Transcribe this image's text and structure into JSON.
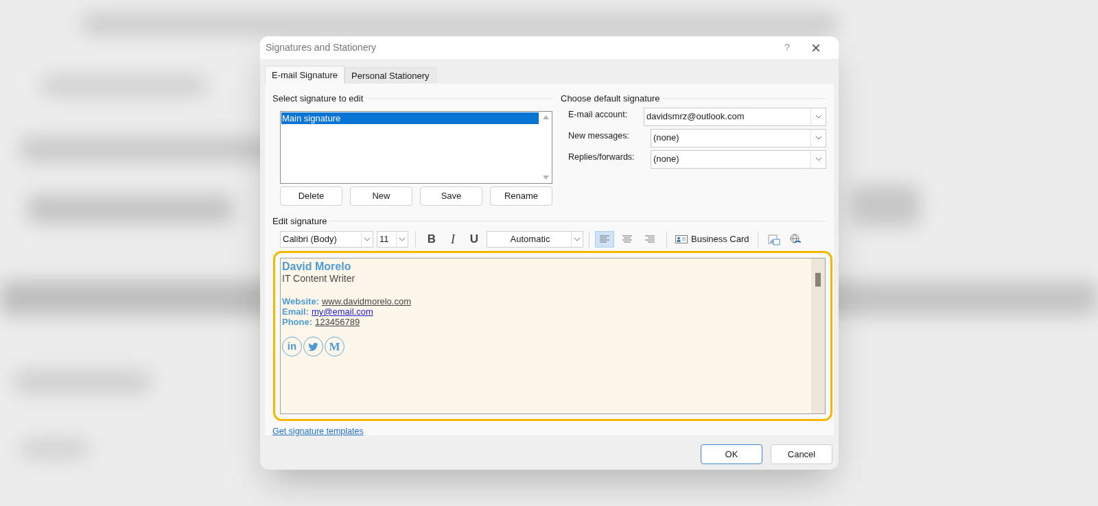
{
  "window": {
    "title": "Signatures and Stationery",
    "help": "?",
    "close": "×"
  },
  "tabs": [
    {
      "label": "E-mail Signature",
      "selected": true
    },
    {
      "label": "Personal Stationery",
      "selected": false
    }
  ],
  "select_signature": {
    "heading": "Select signature to edit",
    "items": [
      {
        "label": "Main signature",
        "selected": true
      }
    ],
    "buttons": [
      "Delete",
      "New",
      "Save",
      "Rename"
    ]
  },
  "default_signature": {
    "heading": "Choose default signature",
    "fields": [
      {
        "label": "E-mail account:",
        "value": "davidsmrz@outlook.com"
      },
      {
        "label": "New messages:",
        "value": "(none)"
      },
      {
        "label": "Replies/forwards:",
        "value": "(none)"
      }
    ]
  },
  "edit_signature": {
    "heading": "Edit signature",
    "toolbar": {
      "font": "Calibri (Body)",
      "size": "11",
      "bold": "B",
      "italic": "I",
      "underline": "U",
      "font_color": "Automatic",
      "align": [
        {
          "kind": "left",
          "selected": true
        },
        {
          "kind": "center",
          "selected": false
        },
        {
          "kind": "right",
          "selected": false
        }
      ],
      "business_card": "Business Card"
    },
    "content": {
      "name": "David Morelo",
      "role": "IT Content Writer",
      "contacts": [
        {
          "label": "Website:",
          "value": "www.davidmorelo.com",
          "kind": "link"
        },
        {
          "label": "Email:",
          "value": "my@email.com",
          "kind": "mail"
        },
        {
          "label": "Phone:",
          "value": "123456789",
          "kind": "link"
        }
      ],
      "social": [
        {
          "kind": "linkedin",
          "text": "in"
        },
        {
          "kind": "twitter"
        },
        {
          "kind": "medium",
          "text": "M"
        }
      ]
    }
  },
  "templates_link": "Get signature templates",
  "buttons": [
    {
      "label": "OK",
      "default": true
    },
    {
      "label": "Cancel",
      "default": false
    }
  ]
}
